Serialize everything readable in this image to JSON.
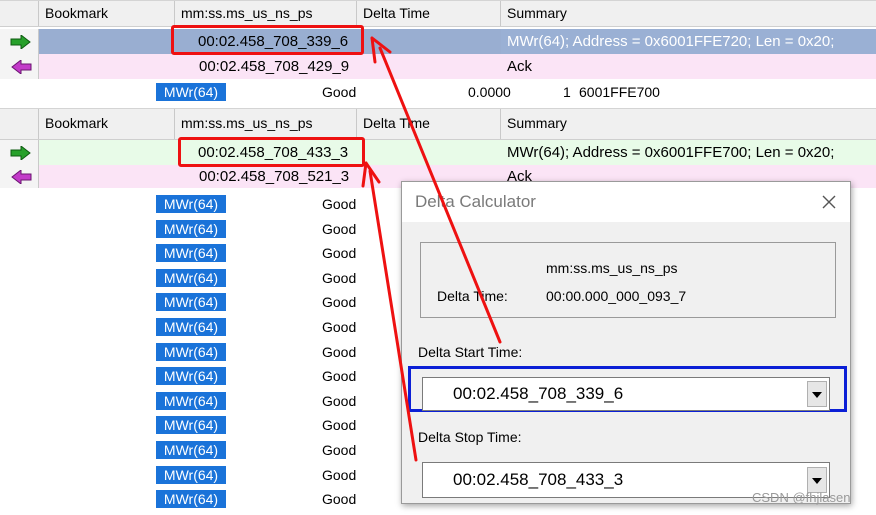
{
  "grid": {
    "columns": [
      "Bookmark",
      "mm:ss.ms_us_ns_ps",
      "Delta Time",
      "Summary"
    ]
  },
  "pane1": {
    "rows": [
      {
        "time": "00:02.458_708_339_6",
        "summary": "MWr(64); Address = 0x6001FFE720; Len = 0x20;"
      },
      {
        "time": "00:02.458_708_429_9",
        "summary": "Ack"
      }
    ],
    "detail": {
      "tag": "MWr(64)",
      "status": "Good",
      "value": "0.0000",
      "count": "1",
      "address": "6001FFE700"
    }
  },
  "pane2": {
    "rows": [
      {
        "time": "00:02.458_708_433_3",
        "summary": "MWr(64); Address = 0x6001FFE700; Len = 0x20;"
      },
      {
        "time": "00:02.458_708_521_3",
        "summary": "Ack"
      }
    ],
    "list": [
      {
        "tag": "MWr(64)",
        "status": "Good"
      },
      {
        "tag": "MWr(64)",
        "status": "Good"
      },
      {
        "tag": "MWr(64)",
        "status": "Good"
      },
      {
        "tag": "MWr(64)",
        "status": "Good"
      },
      {
        "tag": "MWr(64)",
        "status": "Good"
      },
      {
        "tag": "MWr(64)",
        "status": "Good"
      },
      {
        "tag": "MWr(64)",
        "status": "Good"
      },
      {
        "tag": "MWr(64)",
        "status": "Good"
      },
      {
        "tag": "MWr(64)",
        "status": "Good"
      },
      {
        "tag": "MWr(64)",
        "status": "Good"
      },
      {
        "tag": "MWr(64)",
        "status": "Good"
      },
      {
        "tag": "MWr(64)",
        "status": "Good"
      },
      {
        "tag": "MWr(64)",
        "status": "Good"
      }
    ]
  },
  "dialog": {
    "title": "Delta Calculator",
    "format_label": "mm:ss.ms_us_ns_ps",
    "delta_label": "Delta Time:",
    "delta_value": "00:00.000_000_093_7",
    "start_label": "Delta Start Time:",
    "start_value": "00:02.458_708_339_6",
    "stop_label": "Delta Stop Time:",
    "stop_value": "00:02.458_708_433_3"
  },
  "watermark": "CSDN @fhjlasen",
  "colors": {
    "selected_row": "#99aed1",
    "summary_selected": "#9ab0d4",
    "pink_row": "#fbe4f6",
    "green_row": "#e8fbe8",
    "tag_blue": "#1a73d9",
    "annotation_red": "#ee1111",
    "focus_blue": "#0b1fd6"
  }
}
